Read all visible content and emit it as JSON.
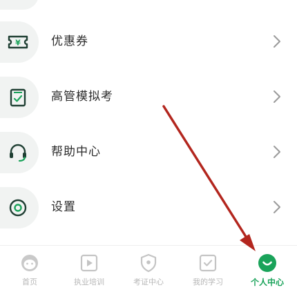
{
  "menu": {
    "items": [
      {
        "label": "优惠券",
        "icon": "coupon-icon"
      },
      {
        "label": "高管模拟考",
        "icon": "exam-icon"
      },
      {
        "label": "帮助中心",
        "icon": "headset-icon"
      },
      {
        "label": "设置",
        "icon": "settings-icon"
      }
    ]
  },
  "tabbar": {
    "tabs": [
      {
        "label": "首页",
        "icon": "home-face-icon",
        "active": false
      },
      {
        "label": "执业培训",
        "icon": "play-icon",
        "active": false
      },
      {
        "label": "考证中心",
        "icon": "shield-icon",
        "active": false
      },
      {
        "label": "我的学习",
        "icon": "check-square-icon",
        "active": false
      },
      {
        "label": "个人中心",
        "icon": "smile-icon",
        "active": true
      }
    ]
  },
  "colors": {
    "accent_green": "#1aa35a",
    "icon_dark": "#1f3f33",
    "annotation_red": "#b3261e",
    "inactive_gray": "#b7b7b7"
  }
}
